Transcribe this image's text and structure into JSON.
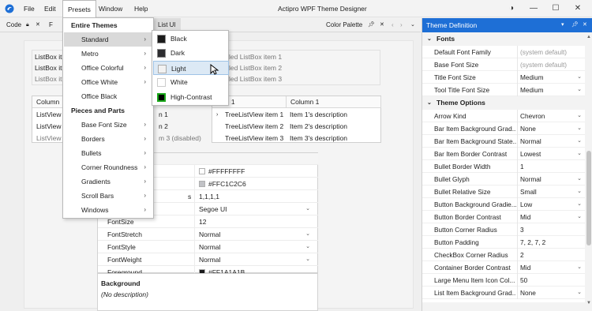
{
  "titlebar": {
    "app_title": "Actipro WPF Theme Designer",
    "menus": [
      "File",
      "Edit",
      "Presets",
      "Window",
      "Help"
    ],
    "controls": {
      "pin": "◑",
      "minimize": "—",
      "maximize": "☐",
      "close": "✕"
    }
  },
  "tabbar": {
    "left_tab": "Code",
    "left_tab_letter": "F",
    "doc_tab_fragment": "List UI",
    "color_palette": "Color Palette"
  },
  "canvas": {
    "listbox_left": [
      "ListBox it",
      "ListBox it",
      "ListBox it"
    ],
    "listbox_right": [
      "led ListBox item 1",
      "led ListBox item 2",
      "led ListBox item 3"
    ],
    "listview": {
      "header": "Column",
      "rows": [
        "ListView",
        "ListView",
        "ListView"
      ],
      "fragment_rows": [
        "n 1",
        "n 2",
        "m 3 (disabled)"
      ]
    },
    "treelistview": {
      "headers": [
        "umn 1",
        "Column 1"
      ],
      "rows": [
        {
          "name": "TreeListView item 1",
          "desc": "Item 1's description"
        },
        {
          "name": "TreeListView item 2",
          "desc": "Item 2's description"
        },
        {
          "name": "TreeListView item 3",
          "desc": "Item 3's description"
        }
      ]
    },
    "property_grid": {
      "rows": [
        {
          "key": "",
          "value": "#FFFFFFFF",
          "swatch": "#ffffff"
        },
        {
          "key": "",
          "value": "#FFC1C2C6",
          "swatch": "#c1c2c6"
        },
        {
          "key": "s",
          "value": "1,1,1,1"
        },
        {
          "key": "",
          "value": "Segoe UI",
          "dropdown": true
        },
        {
          "key": "FontSize",
          "value": "12"
        },
        {
          "key": "FontStretch",
          "value": "Normal",
          "dropdown": true
        },
        {
          "key": "FontStyle",
          "value": "Normal",
          "dropdown": true
        },
        {
          "key": "FontWeight",
          "value": "Normal",
          "dropdown": true
        },
        {
          "key": "Foreground",
          "value": "#FF1A1A1B",
          "swatch": "#1a1a1b"
        }
      ],
      "description_title": "Background",
      "description_text": "(No description)"
    }
  },
  "presets_menu": {
    "section1": "Entire Themes",
    "theme_items": [
      "Standard",
      "Metro",
      "Office Colorful",
      "Office White",
      "Office Black"
    ],
    "section2": "Pieces and Parts",
    "part_items": [
      "Base Font Size",
      "Borders",
      "Bullets",
      "Corner Roundness",
      "Gradients",
      "Scroll Bars",
      "Windows"
    ]
  },
  "standard_submenu": {
    "items": [
      {
        "label": "Black",
        "color": "#1b1b1b"
      },
      {
        "label": "Dark",
        "color": "#2d2d30"
      },
      {
        "label": "Light",
        "color": "#f2f2f2"
      },
      {
        "label": "White",
        "color": "#ffffff"
      },
      {
        "label": "High-Contrast",
        "color": "#000000"
      }
    ]
  },
  "theme_definition": {
    "title": "Theme Definition",
    "sections": [
      {
        "name": "Fonts",
        "rows": [
          {
            "key": "Default Font Family",
            "value": "(system default)",
            "dim": true
          },
          {
            "key": "Base Font Size",
            "value": "(system default)",
            "dim": true
          },
          {
            "key": "Title Font Size",
            "value": "Medium",
            "dropdown": true
          },
          {
            "key": "Tool Title Font Size",
            "value": "Medium",
            "dropdown": true
          }
        ]
      },
      {
        "name": "Theme Options",
        "rows": [
          {
            "key": "Arrow Kind",
            "value": "Chevron",
            "dropdown": true
          },
          {
            "key": "Bar Item Background Grad...",
            "value": "None",
            "dropdown": true
          },
          {
            "key": "Bar Item Background State...",
            "value": "Normal",
            "dropdown": true
          },
          {
            "key": "Bar Item Border Contrast",
            "value": "Lowest",
            "dropdown": true
          },
          {
            "key": "Bullet Border Width",
            "value": "1"
          },
          {
            "key": "Bullet Glyph",
            "value": "Normal",
            "dropdown": true
          },
          {
            "key": "Bullet Relative Size",
            "value": "Small",
            "dropdown": true
          },
          {
            "key": "Button Background Gradie...",
            "value": "Low",
            "dropdown": true
          },
          {
            "key": "Button Border Contrast",
            "value": "Mid",
            "dropdown": true
          },
          {
            "key": "Button Corner Radius",
            "value": "3"
          },
          {
            "key": "Button Padding",
            "value": "7, 2, 7, 2"
          },
          {
            "key": "CheckBox Corner Radius",
            "value": "2"
          },
          {
            "key": "Container Border Contrast",
            "value": "Mid",
            "dropdown": true
          },
          {
            "key": "Large Menu Item Icon Col...",
            "value": "50"
          },
          {
            "key": "List Item Background Grad...",
            "value": "None",
            "dropdown": true
          }
        ]
      }
    ]
  },
  "colors": {
    "accent": "#1e6fd6",
    "menu_highlight": "#dce9f5"
  }
}
